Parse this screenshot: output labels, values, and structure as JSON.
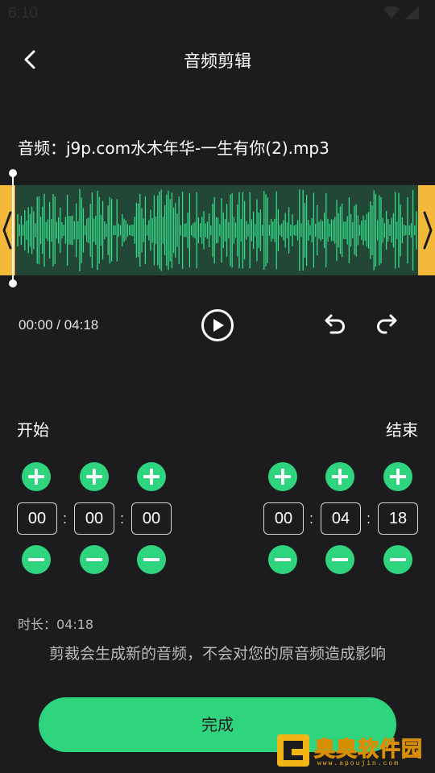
{
  "status_bar": {
    "time": "6:10",
    "wifi_icon": "wifi-icon",
    "signal_icon": "signal-icon"
  },
  "header": {
    "title": "音频剪辑",
    "back_icon": "chevron-left-icon"
  },
  "file": {
    "label": "音频：j9p.com水木年华-一生有你(2).mp3"
  },
  "player": {
    "time_readout": "00:00 / 04:18",
    "play_icon": "play-icon",
    "undo_icon": "undo-icon",
    "redo_icon": "redo-icon"
  },
  "start": {
    "label": "开始",
    "hours": "00",
    "minutes": "00",
    "seconds": "00"
  },
  "end": {
    "label": "结束",
    "hours": "00",
    "minutes": "04",
    "seconds": "18"
  },
  "separator": ":",
  "duration": "时长：04:18",
  "hint": "剪裁会生成新的音频，不会对您的原音频造成影响",
  "done_button": "完成",
  "watermark": {
    "text": "奥奥软件园",
    "url": "www.apoujin.com"
  },
  "colors": {
    "accent": "#2fd47f",
    "handle": "#f4b93a",
    "wave_bg": "#224737",
    "background": "#1c1c1e"
  }
}
